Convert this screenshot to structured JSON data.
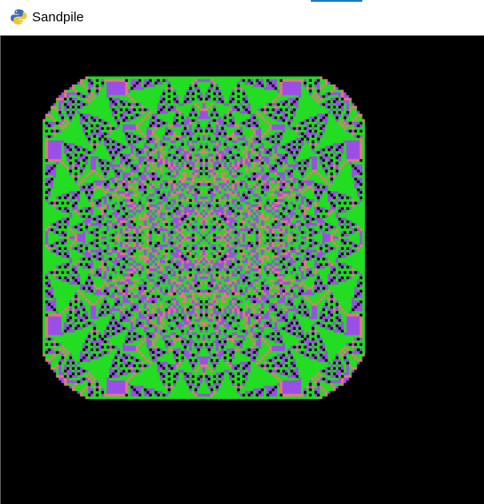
{
  "window": {
    "title": "Sandpile",
    "icon": "python-snake-icon"
  },
  "canvas": {
    "background": "#000000",
    "palette": {
      "grains_0": "#000000",
      "grains_1": "#e87878",
      "grains_2": "#9b4fe6",
      "grains_3": "#22dd22"
    }
  }
}
